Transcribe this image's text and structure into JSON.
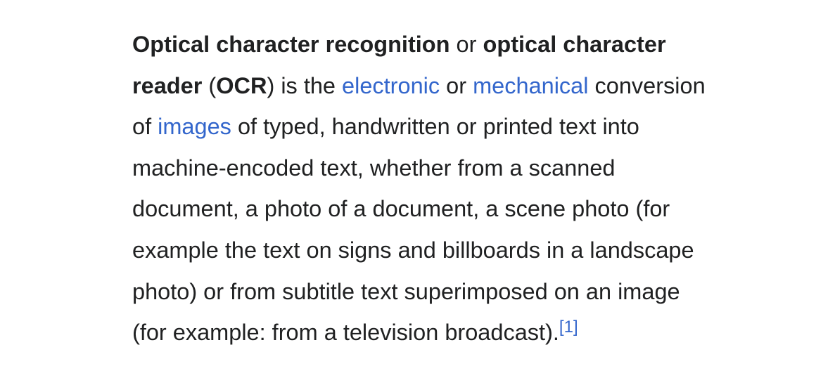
{
  "paragraph": {
    "term_1": "Optical character recognition",
    "or_1": " or ",
    "term_2a": "optical character",
    "term_2b": "reader",
    "paren_open": " (",
    "abbr": "OCR",
    "after_abbr": ") is the ",
    "link_electronic": "electronic",
    "or_2": " or ",
    "link_mechanical": "mechanical",
    "after_mechanical": " conversion",
    "of_word": "of ",
    "link_images": "images",
    "after_images": " of typed, handwritten or printed text into",
    "line_4": "machine-encoded text, whether from a scanned",
    "line_5": "document, a photo of a document, a scene photo (for",
    "line_6": "example the text on signs and billboards in a landscape",
    "line_7": "photo) or from subtitle text superimposed on an image",
    "line_8": "(for example: from a television broadcast).",
    "citation": "[1]"
  },
  "colors": {
    "text": "#202122",
    "link": "#3366cc",
    "background": "#ffffff"
  }
}
